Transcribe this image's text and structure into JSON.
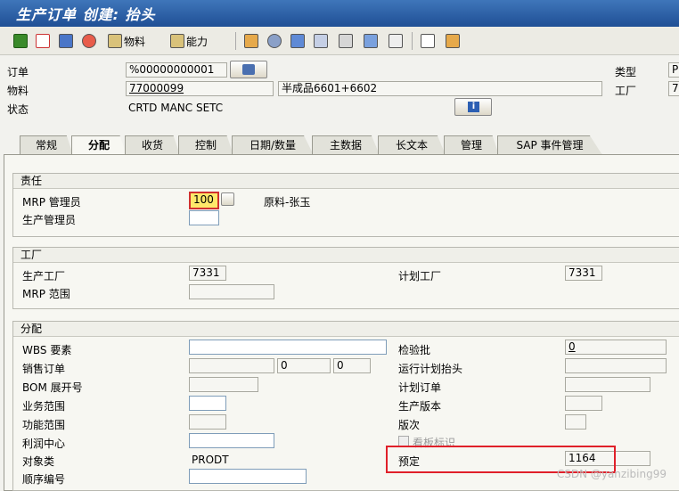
{
  "window": {
    "title": "生产订单 创建: 抬头"
  },
  "toolbar": {
    "material_label": "物料",
    "capacity_label": "能力"
  },
  "header": {
    "order_label": "订单",
    "order_value": "%00000000001",
    "type_label": "类型",
    "type_value": "P",
    "material_label": "物料",
    "material_value": "77000099",
    "material_desc": "半成品6601+6602",
    "plant_label": "工厂",
    "plant_value": "7",
    "status_label": "状态",
    "status_value": "CRTD MANC SETC"
  },
  "tabs": [
    "常规",
    "分配",
    "收货",
    "控制",
    "日期/数量",
    "主数据",
    "长文本",
    "管理",
    "SAP 事件管理"
  ],
  "responsibility": {
    "title": "责任",
    "mrp_controller_label": "MRP 管理员",
    "mrp_controller_value": "100",
    "mrp_controller_desc": "原料-张玉",
    "prod_supervisor_label": "生产管理员",
    "prod_supervisor_value": ""
  },
  "plant_group": {
    "title": "工厂",
    "prod_plant_label": "生产工厂",
    "prod_plant_value": "7331",
    "planning_plant_label": "计划工厂",
    "planning_plant_value": "7331",
    "mrp_area_label": "MRP 范围",
    "mrp_area_value": ""
  },
  "assignment": {
    "title": "分配",
    "wbs_label": "WBS 要素",
    "inspection_lot_label": "检验批",
    "inspection_lot_value": "0",
    "sales_order_label": "销售订单",
    "sales_order_item": "0",
    "sales_order_sched": "0",
    "run_schedule_label": "运行计划抬头",
    "bom_explosion_label": "BOM 展开号",
    "planned_order_label": "计划订单",
    "business_area_label": "业务范围",
    "production_version_label": "生产版本",
    "functional_area_label": "功能范围",
    "version_label": "版次",
    "profit_center_label": "利润中心",
    "kanban_label": "看板标识",
    "object_class_label": "对象类",
    "object_class_value": "PRODT",
    "reservation_label": "预定",
    "reservation_value": "1164",
    "sequence_label": "顺序编号"
  },
  "watermark": "CSDN @yanzibing99"
}
